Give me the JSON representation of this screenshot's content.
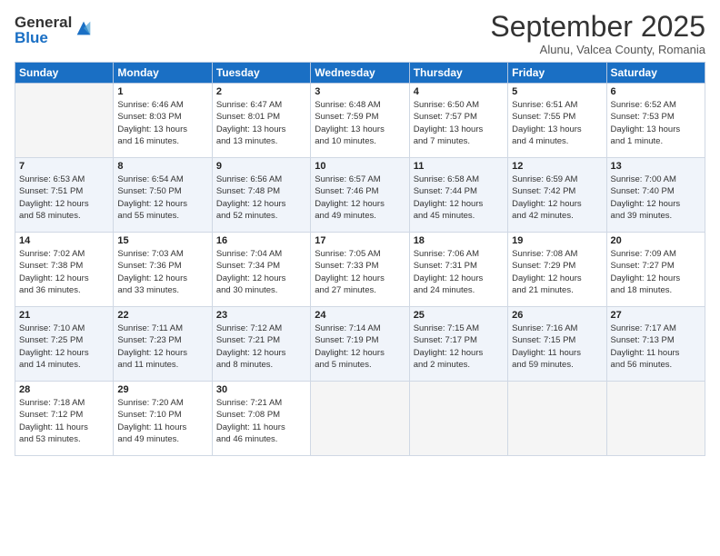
{
  "logo": {
    "general": "General",
    "blue": "Blue"
  },
  "header": {
    "month": "September 2025",
    "location": "Alunu, Valcea County, Romania"
  },
  "days_of_week": [
    "Sunday",
    "Monday",
    "Tuesday",
    "Wednesday",
    "Thursday",
    "Friday",
    "Saturday"
  ],
  "weeks": [
    [
      {
        "day": "",
        "info": ""
      },
      {
        "day": "1",
        "info": "Sunrise: 6:46 AM\nSunset: 8:03 PM\nDaylight: 13 hours\nand 16 minutes."
      },
      {
        "day": "2",
        "info": "Sunrise: 6:47 AM\nSunset: 8:01 PM\nDaylight: 13 hours\nand 13 minutes."
      },
      {
        "day": "3",
        "info": "Sunrise: 6:48 AM\nSunset: 7:59 PM\nDaylight: 13 hours\nand 10 minutes."
      },
      {
        "day": "4",
        "info": "Sunrise: 6:50 AM\nSunset: 7:57 PM\nDaylight: 13 hours\nand 7 minutes."
      },
      {
        "day": "5",
        "info": "Sunrise: 6:51 AM\nSunset: 7:55 PM\nDaylight: 13 hours\nand 4 minutes."
      },
      {
        "day": "6",
        "info": "Sunrise: 6:52 AM\nSunset: 7:53 PM\nDaylight: 13 hours\nand 1 minute."
      }
    ],
    [
      {
        "day": "7",
        "info": "Sunrise: 6:53 AM\nSunset: 7:51 PM\nDaylight: 12 hours\nand 58 minutes."
      },
      {
        "day": "8",
        "info": "Sunrise: 6:54 AM\nSunset: 7:50 PM\nDaylight: 12 hours\nand 55 minutes."
      },
      {
        "day": "9",
        "info": "Sunrise: 6:56 AM\nSunset: 7:48 PM\nDaylight: 12 hours\nand 52 minutes."
      },
      {
        "day": "10",
        "info": "Sunrise: 6:57 AM\nSunset: 7:46 PM\nDaylight: 12 hours\nand 49 minutes."
      },
      {
        "day": "11",
        "info": "Sunrise: 6:58 AM\nSunset: 7:44 PM\nDaylight: 12 hours\nand 45 minutes."
      },
      {
        "day": "12",
        "info": "Sunrise: 6:59 AM\nSunset: 7:42 PM\nDaylight: 12 hours\nand 42 minutes."
      },
      {
        "day": "13",
        "info": "Sunrise: 7:00 AM\nSunset: 7:40 PM\nDaylight: 12 hours\nand 39 minutes."
      }
    ],
    [
      {
        "day": "14",
        "info": "Sunrise: 7:02 AM\nSunset: 7:38 PM\nDaylight: 12 hours\nand 36 minutes."
      },
      {
        "day": "15",
        "info": "Sunrise: 7:03 AM\nSunset: 7:36 PM\nDaylight: 12 hours\nand 33 minutes."
      },
      {
        "day": "16",
        "info": "Sunrise: 7:04 AM\nSunset: 7:34 PM\nDaylight: 12 hours\nand 30 minutes."
      },
      {
        "day": "17",
        "info": "Sunrise: 7:05 AM\nSunset: 7:33 PM\nDaylight: 12 hours\nand 27 minutes."
      },
      {
        "day": "18",
        "info": "Sunrise: 7:06 AM\nSunset: 7:31 PM\nDaylight: 12 hours\nand 24 minutes."
      },
      {
        "day": "19",
        "info": "Sunrise: 7:08 AM\nSunset: 7:29 PM\nDaylight: 12 hours\nand 21 minutes."
      },
      {
        "day": "20",
        "info": "Sunrise: 7:09 AM\nSunset: 7:27 PM\nDaylight: 12 hours\nand 18 minutes."
      }
    ],
    [
      {
        "day": "21",
        "info": "Sunrise: 7:10 AM\nSunset: 7:25 PM\nDaylight: 12 hours\nand 14 minutes."
      },
      {
        "day": "22",
        "info": "Sunrise: 7:11 AM\nSunset: 7:23 PM\nDaylight: 12 hours\nand 11 minutes."
      },
      {
        "day": "23",
        "info": "Sunrise: 7:12 AM\nSunset: 7:21 PM\nDaylight: 12 hours\nand 8 minutes."
      },
      {
        "day": "24",
        "info": "Sunrise: 7:14 AM\nSunset: 7:19 PM\nDaylight: 12 hours\nand 5 minutes."
      },
      {
        "day": "25",
        "info": "Sunrise: 7:15 AM\nSunset: 7:17 PM\nDaylight: 12 hours\nand 2 minutes."
      },
      {
        "day": "26",
        "info": "Sunrise: 7:16 AM\nSunset: 7:15 PM\nDaylight: 11 hours\nand 59 minutes."
      },
      {
        "day": "27",
        "info": "Sunrise: 7:17 AM\nSunset: 7:13 PM\nDaylight: 11 hours\nand 56 minutes."
      }
    ],
    [
      {
        "day": "28",
        "info": "Sunrise: 7:18 AM\nSunset: 7:12 PM\nDaylight: 11 hours\nand 53 minutes."
      },
      {
        "day": "29",
        "info": "Sunrise: 7:20 AM\nSunset: 7:10 PM\nDaylight: 11 hours\nand 49 minutes."
      },
      {
        "day": "30",
        "info": "Sunrise: 7:21 AM\nSunset: 7:08 PM\nDaylight: 11 hours\nand 46 minutes."
      },
      {
        "day": "",
        "info": ""
      },
      {
        "day": "",
        "info": ""
      },
      {
        "day": "",
        "info": ""
      },
      {
        "day": "",
        "info": ""
      }
    ]
  ]
}
